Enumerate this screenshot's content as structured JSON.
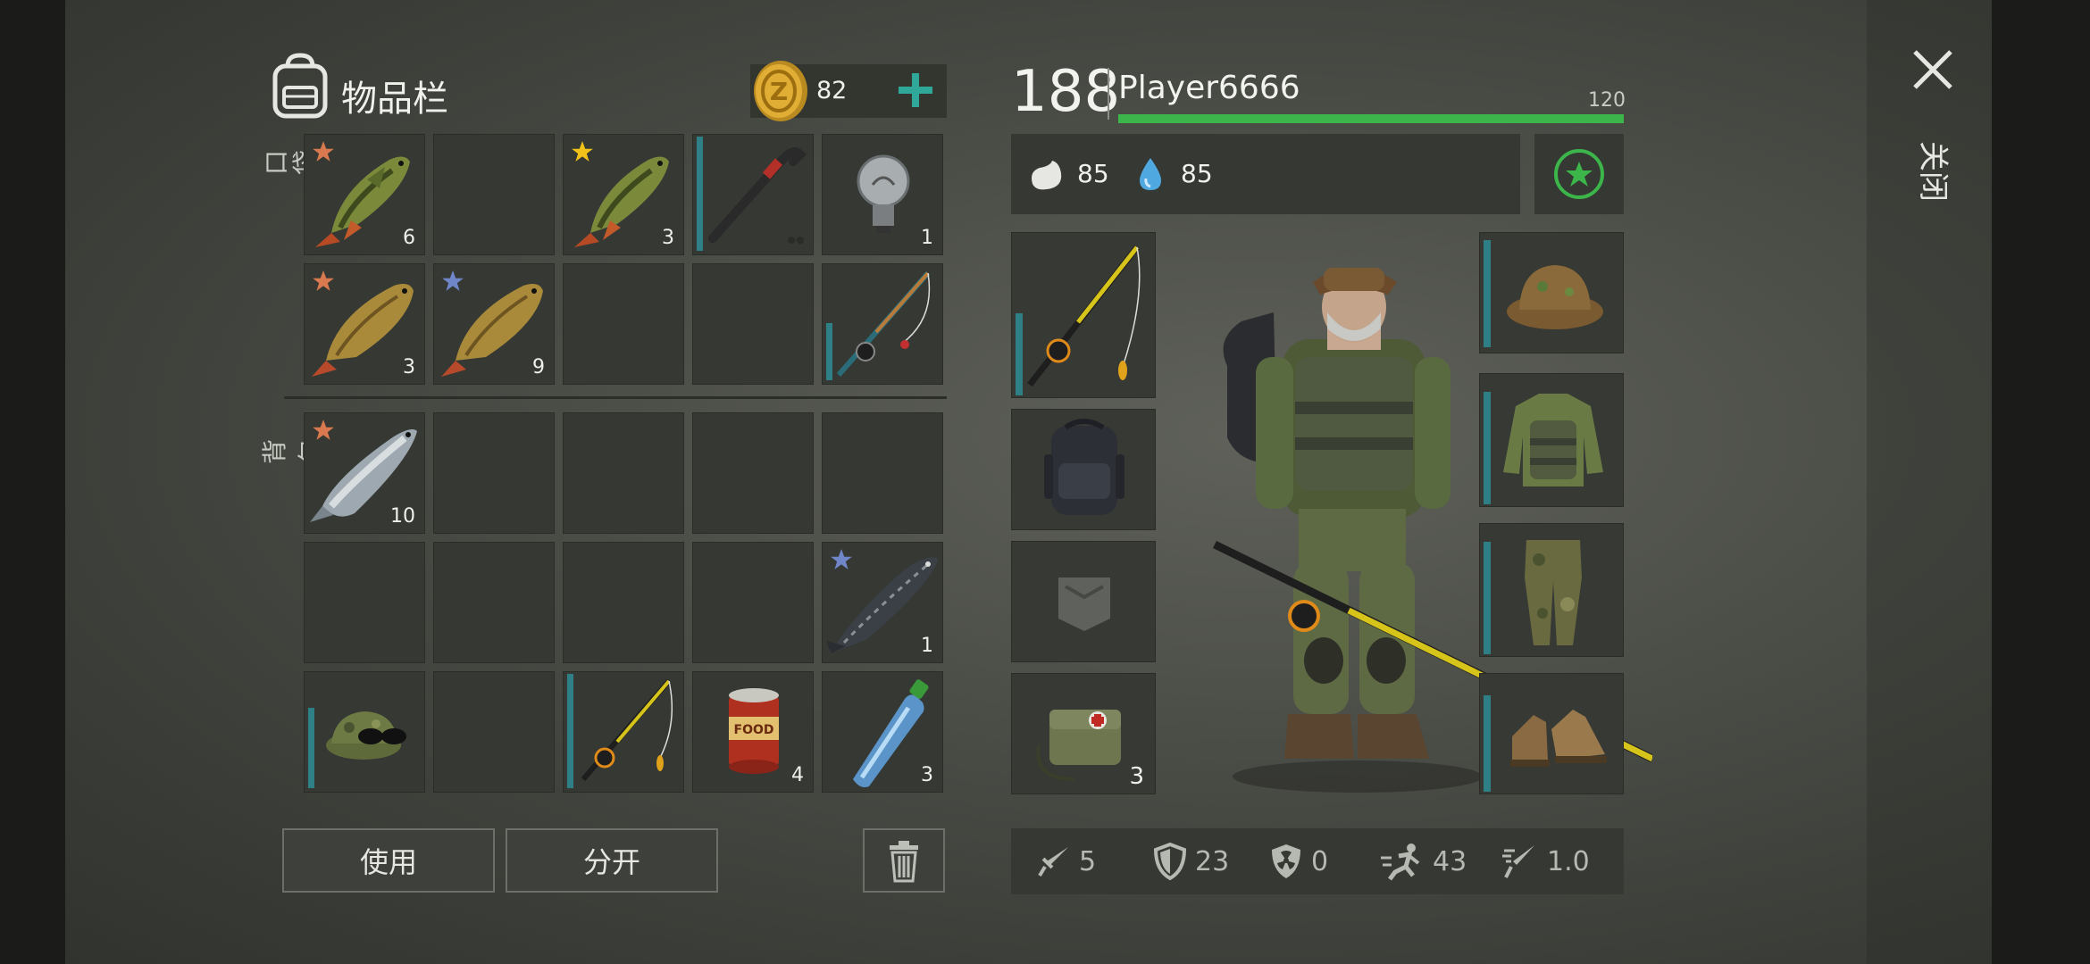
{
  "inventory": {
    "title": "物品栏",
    "coins": "82",
    "add_icon": "plus-icon",
    "section_pocket": "口袋",
    "section_backpack": "背包",
    "pocket_slots": [
      {
        "item": "perch-fish",
        "count": "6",
        "star": "bronze"
      },
      {
        "item": "",
        "count": "",
        "star": ""
      },
      {
        "item": "perch-fish",
        "count": "3",
        "star": "gold"
      },
      {
        "item": "crowbar",
        "count": "",
        "star": ""
      },
      {
        "item": "light-bulb",
        "count": "1",
        "star": ""
      },
      {
        "item": "carp-fish",
        "count": "3",
        "star": "bronze"
      },
      {
        "item": "carp-fish",
        "count": "9",
        "star": "blue"
      },
      {
        "item": "",
        "count": "",
        "star": ""
      },
      {
        "item": "",
        "count": "",
        "star": ""
      },
      {
        "item": "fishing-rod",
        "count": "",
        "star": ""
      }
    ],
    "backpack_slots": [
      {
        "item": "salmon-fish",
        "count": "10",
        "star": "bronze"
      },
      {
        "item": "sturgeon-fish",
        "count": "1",
        "star": "blue"
      },
      {
        "item": "camo-cap",
        "count": "",
        "star": ""
      },
      {
        "item": "fishing-rod",
        "count": "",
        "star": ""
      },
      {
        "item": "canned-food",
        "count": "4",
        "star": ""
      },
      {
        "item": "water-bottle",
        "count": "3",
        "star": ""
      }
    ],
    "food_can_label": "FOOD",
    "use_button": "使用",
    "split_button": "分开",
    "trash_icon": "trash-icon"
  },
  "player": {
    "level": "188",
    "name": "Player6666",
    "max_health": "120",
    "health_fraction": 1.0,
    "hunger": "85",
    "thirst": "85",
    "medkit_count": "3",
    "health_color": "#3cb54a",
    "accent_color": "#2fa89a"
  },
  "stats": [
    {
      "icon": "sword-icon",
      "value": "5"
    },
    {
      "icon": "shield-icon",
      "value": "23"
    },
    {
      "icon": "radiation-shield-icon",
      "value": "0"
    },
    {
      "icon": "running-icon",
      "value": "43"
    },
    {
      "icon": "speed-icon",
      "value": "1.0"
    }
  ],
  "close_label": "关闭"
}
